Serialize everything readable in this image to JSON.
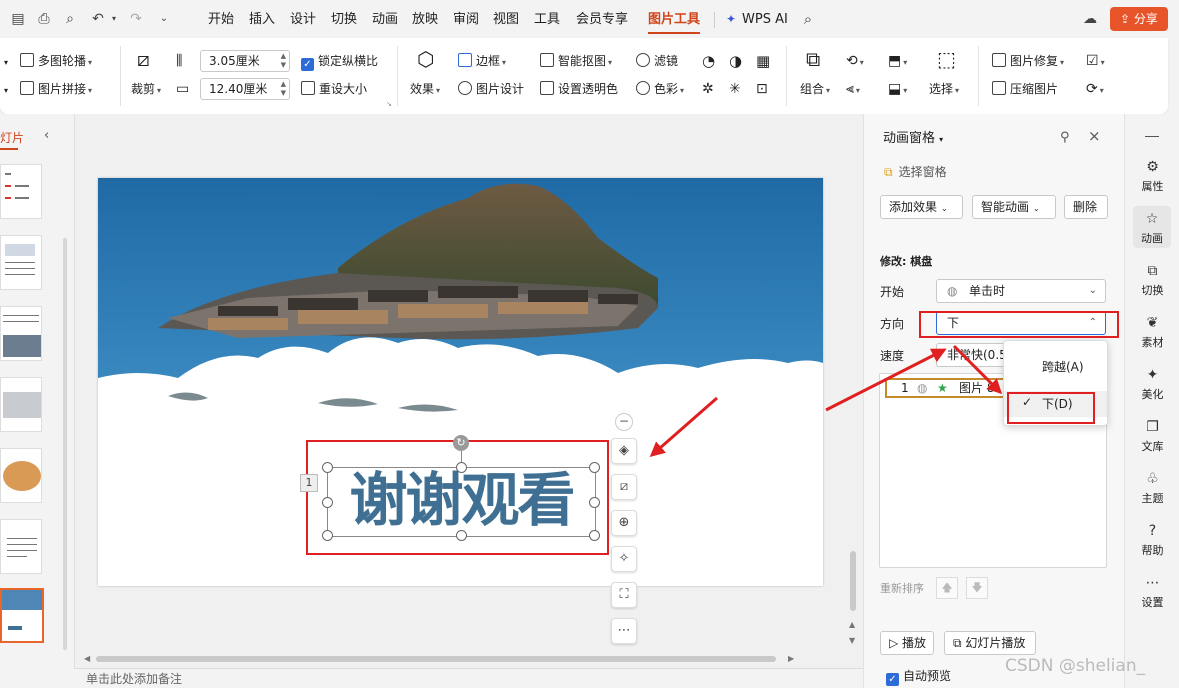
{
  "menubar": {
    "tabs": [
      "开始",
      "插入",
      "设计",
      "切换",
      "动画",
      "放映",
      "审阅",
      "视图",
      "工具",
      "会员专享",
      "图片工具"
    ],
    "active_tab": "图片工具",
    "wps_ai": "WPS AI",
    "share": "分享"
  },
  "ribbon": {
    "multi_outline": "多图轮播",
    "picture_stitch": "图片拼接",
    "crop": "裁剪",
    "width_value": "3.05厘米",
    "height_value": "12.40厘米",
    "lock_ratio": "锁定纵横比",
    "reset_size": "重设大小",
    "effects": "效果",
    "border": "边框",
    "picture_design": "图片设计",
    "smart_cutout": "智能抠图",
    "set_transparent": "设置透明色",
    "filter": "滤镜",
    "color": "色彩",
    "group": "组合",
    "select": "选择",
    "picture_repair": "图片修复",
    "compress": "压缩图片"
  },
  "slides_panel": {
    "header": "幻灯片"
  },
  "slide": {
    "thanks_text": "谢谢观看",
    "anim_badge": "1"
  },
  "notes_placeholder": "单击此处添加备注",
  "anim_pane": {
    "title": "动画窗格",
    "select_pane": "选择窗格",
    "add_effect": "添加效果",
    "smart_anim": "智能动画",
    "delete": "删除",
    "modify": "修改: 棋盘",
    "start_label": "开始",
    "start_value": "单击时",
    "direction_label": "方向",
    "direction_value": "下",
    "speed_label": "速度",
    "speed_value": "非常快(0.5",
    "item_num": "1",
    "item_name": "图片 8",
    "reorder": "重新排序",
    "play": "播放",
    "slideshow": "幻灯片播放",
    "auto_preview": "自动预览"
  },
  "dropdown": {
    "options": [
      "跨越(A)",
      "下(D)"
    ],
    "selected": "下(D)"
  },
  "rail": {
    "items": [
      "属性",
      "动画",
      "切换",
      "素材",
      "美化",
      "文库",
      "主题",
      "帮助",
      "设置"
    ],
    "active": "动画"
  },
  "watermark": "CSDN @shelian_",
  "colors": {
    "accent": "#e8542a",
    "annotation_red": "#e02020",
    "checkbox_blue": "#2d6bd6"
  }
}
